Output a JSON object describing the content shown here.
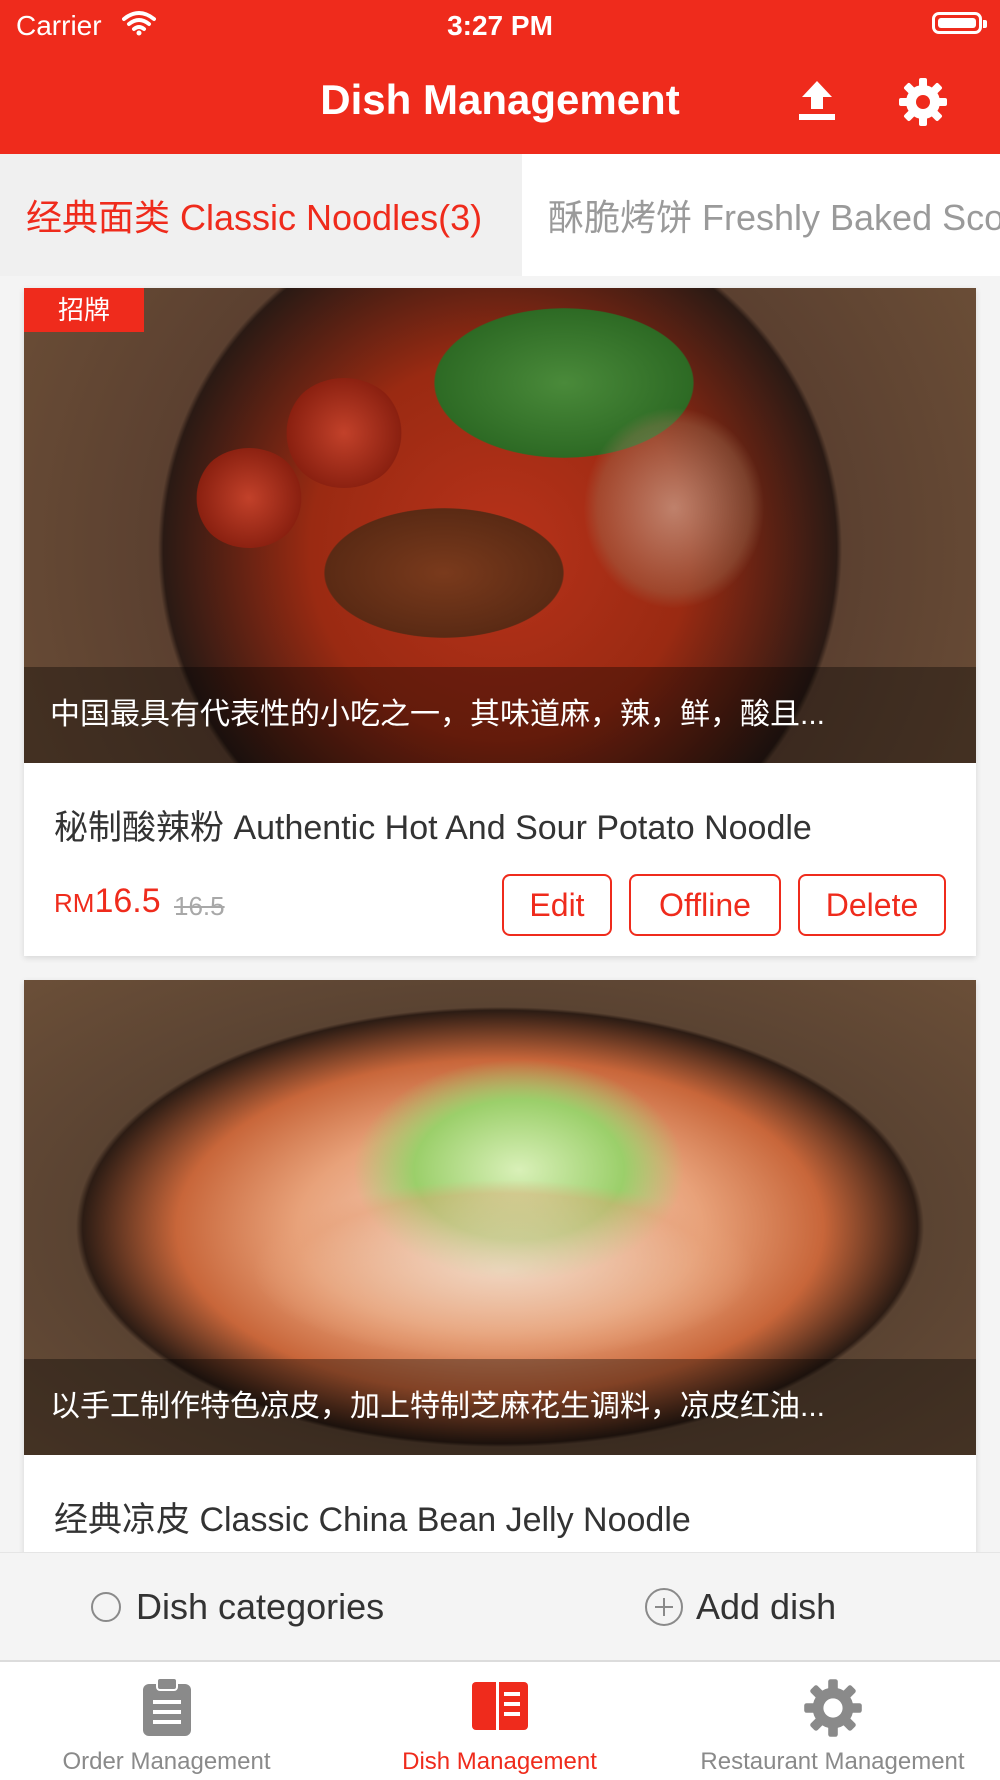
{
  "status_bar": {
    "carrier": "Carrier",
    "time": "3:27 PM"
  },
  "header": {
    "title": "Dish Management",
    "upload_icon": "upload-icon",
    "settings_icon": "gear-icon"
  },
  "category_tabs": [
    {
      "label": "经典面类 Classic Noodles(3)",
      "active": true
    },
    {
      "label": "酥脆烤饼 Freshly Baked Sco",
      "active": false
    }
  ],
  "dishes": [
    {
      "badge": "招牌",
      "caption": "中国最具有代表性的小吃之一，其味道麻，辣，鲜，酸且...",
      "name": "秘制酸辣粉 Authentic Hot And Sour Potato Noodle",
      "currency": "RM",
      "price": "16.5",
      "original_price": "16.5",
      "edit_label": "Edit",
      "offline_label": "Offline",
      "delete_label": "Delete"
    },
    {
      "caption": "以手工制作特色凉皮，加上特制芝麻花生调料，凉皮红油...",
      "name": "经典凉皮 Classic China Bean Jelly Noodle"
    }
  ],
  "bottom_actions": {
    "categories_label": "Dish categories",
    "add_label": "Add dish"
  },
  "tab_bar": [
    {
      "label": "Order Management",
      "icon": "clipboard-icon",
      "active": false
    },
    {
      "label": "Dish Management",
      "icon": "menu-book-icon",
      "active": true
    },
    {
      "label": "Restaurant Management",
      "icon": "gear-icon",
      "active": false
    }
  ],
  "colors": {
    "accent": "#ef2b1c",
    "muted": "#8a8a8a"
  }
}
